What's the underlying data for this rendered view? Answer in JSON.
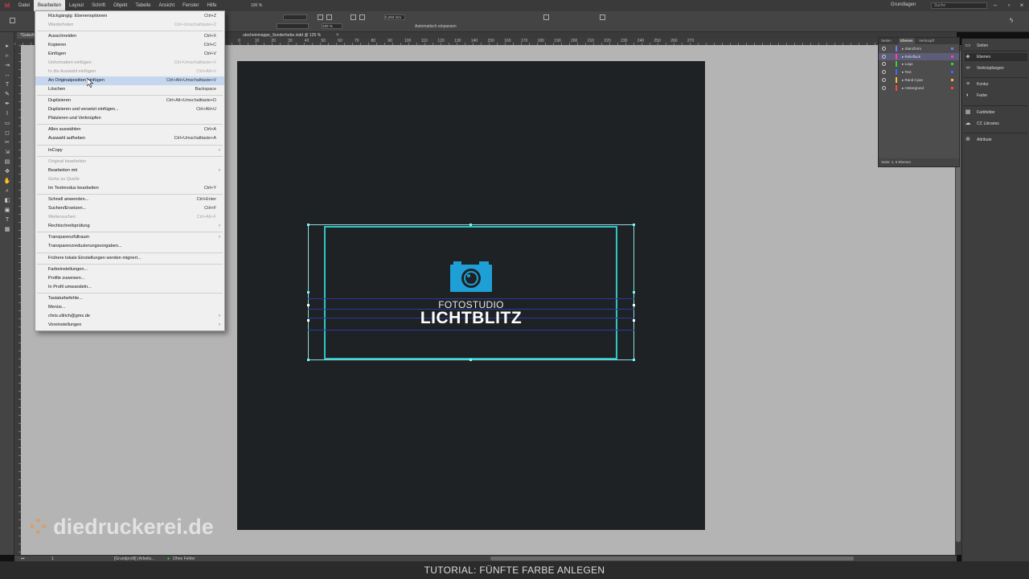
{
  "menubar": {
    "app_logo": "Id",
    "items": [
      "Datei",
      "Bearbeiten",
      "Layout",
      "Schrift",
      "Objekt",
      "Tabelle",
      "Ansicht",
      "Fenster",
      "Hilfe"
    ],
    "zoom": "100 %",
    "workspace": "Grundlagen",
    "search_placeholder": "Suche"
  },
  "controlbar": {
    "stroke_value": "0,283 mm",
    "opacity_value": "100 %",
    "auto_fit_label": "Automatisch einpassen"
  },
  "document": {
    "tab_left": "*Gutsche",
    "tab_title": "utscheinmappe_Sonderfarbe.indd @ 125 %"
  },
  "ruler_labels": [
    "0",
    "10",
    "20",
    "30",
    "40",
    "50",
    "60",
    "70",
    "80",
    "90",
    "100",
    "110",
    "120",
    "130",
    "140",
    "150",
    "160",
    "170",
    "180",
    "190",
    "200",
    "210",
    "220",
    "230",
    "240",
    "250",
    "260",
    "270"
  ],
  "edit_menu": [
    {
      "label": "Rückgängig: Ebenenoptionen",
      "shortcut": "Ctrl+Z",
      "disabled": false
    },
    {
      "label": "Wiederholen",
      "shortcut": "Ctrl+Umschalttaste+Z",
      "disabled": true
    },
    {
      "sep": true
    },
    {
      "label": "Ausschneiden",
      "shortcut": "Ctrl+X",
      "disabled": false
    },
    {
      "label": "Kopieren",
      "shortcut": "Ctrl+C",
      "disabled": false
    },
    {
      "label": "Einfügen",
      "shortcut": "Ctrl+V",
      "disabled": false
    },
    {
      "label": "Unformatiert einfügen",
      "shortcut": "Ctrl+Umschalttaste+V",
      "disabled": true
    },
    {
      "label": "In die Auswahl einfügen",
      "shortcut": "Ctrl+Alt+V",
      "disabled": true
    },
    {
      "label": "An Originalposition einfügen",
      "shortcut": "Ctrl+Alt+Umschalttaste+V",
      "disabled": false,
      "highlight": true
    },
    {
      "label": "Löschen",
      "shortcut": "Backspace",
      "disabled": false
    },
    {
      "sep": true
    },
    {
      "label": "Duplizieren",
      "shortcut": "Ctrl+Alt+Umschalttaste+D",
      "disabled": false
    },
    {
      "label": "Duplizieren und versetzt einfügen...",
      "shortcut": "Ctrl+Alt+U",
      "disabled": false
    },
    {
      "label": "Platzieren und Verknüpfen",
      "shortcut": "",
      "disabled": false
    },
    {
      "sep": true
    },
    {
      "label": "Alles auswählen",
      "shortcut": "Ctrl+A",
      "disabled": false
    },
    {
      "label": "Auswahl aufheben",
      "shortcut": "Ctrl+Umschalttaste+A",
      "disabled": false
    },
    {
      "sep": true
    },
    {
      "label": "InCopy",
      "shortcut": "",
      "submenu": true,
      "disabled": false
    },
    {
      "sep": true
    },
    {
      "label": "Original bearbeiten",
      "shortcut": "",
      "disabled": true
    },
    {
      "label": "Bearbeiten mit",
      "shortcut": "",
      "submenu": true,
      "disabled": false
    },
    {
      "label": "Gehe zu Quelle",
      "shortcut": "",
      "disabled": true
    },
    {
      "label": "Im Textmodus bearbeiten",
      "shortcut": "Ctrl+Y",
      "disabled": false
    },
    {
      "sep": true
    },
    {
      "label": "Schnell anwenden...",
      "shortcut": "Ctrl+Enter",
      "disabled": false
    },
    {
      "label": "Suchen/Ersetzen...",
      "shortcut": "Ctrl+F",
      "disabled": false
    },
    {
      "label": "Weitersuchen",
      "shortcut": "Ctrl+Alt+F",
      "disabled": true
    },
    {
      "label": "Rechtschreibprüfung",
      "shortcut": "",
      "submenu": true,
      "disabled": false
    },
    {
      "sep": true
    },
    {
      "label": "Transparenzfüllraum",
      "shortcut": "",
      "submenu": true,
      "disabled": false
    },
    {
      "label": "Transparenzreduzierungsvorgaben...",
      "shortcut": "",
      "disabled": false
    },
    {
      "sep": true
    },
    {
      "label": "Frühere lokale Einstellungen werden migriert...",
      "shortcut": "",
      "disabled": false
    },
    {
      "sep": true
    },
    {
      "label": "Farbeinstellungen...",
      "shortcut": "",
      "disabled": false
    },
    {
      "label": "Profile zuweisen...",
      "shortcut": "",
      "disabled": false
    },
    {
      "label": "In Profil umwandeln...",
      "shortcut": "",
      "disabled": false
    },
    {
      "sep": true
    },
    {
      "label": "Tastaturbefehle...",
      "shortcut": "",
      "disabled": false
    },
    {
      "label": "Menüs...",
      "shortcut": "",
      "disabled": false
    },
    {
      "label": "chris.ullrich@gmx.de",
      "shortcut": "",
      "submenu": true,
      "disabled": false
    },
    {
      "label": "Voreinstellungen",
      "shortcut": "",
      "submenu": true,
      "disabled": false
    }
  ],
  "artwork": {
    "line1": "FOTOSTUDIO",
    "line2": "LICHTBLITZ",
    "accent": "#2fc5c5",
    "camera_color": "#1ea0d6"
  },
  "layers_panel": {
    "tabs": [
      "Seiten",
      "Ebenen",
      "Verknüpfl"
    ],
    "layers": [
      {
        "name": "Stanzform",
        "color": "#7777ff",
        "selected": false
      },
      {
        "name": "Relieflack",
        "color": "#ff3fb4",
        "selected": true
      },
      {
        "name": "Logo",
        "color": "#3ad13a",
        "selected": false
      },
      {
        "name": "Text",
        "color": "#3a6bff",
        "selected": false
      },
      {
        "name": "Rand Cyan",
        "color": "#ffbb33",
        "selected": false
      },
      {
        "name": "Hintergrund",
        "color": "#ff4444",
        "selected": false
      }
    ],
    "footer": "Seite: 1, 6 Ebenen"
  },
  "right_panels": [
    {
      "label": "Seiten",
      "icon": "▭",
      "active": false
    },
    {
      "label": "Ebenen",
      "icon": "◈",
      "active": true
    },
    {
      "label": "Verknüpfungen",
      "icon": "∞",
      "active": false
    },
    {
      "label": "Kontur",
      "icon": "≡",
      "active": false
    },
    {
      "label": "Farbe",
      "icon": "◐",
      "active": false
    },
    {
      "label": "Farbfelder",
      "icon": "▦",
      "active": false
    },
    {
      "label": "CC Libraries",
      "icon": "☁",
      "active": false
    },
    {
      "label": "Attribute",
      "icon": "⊕",
      "active": false
    }
  ],
  "statusbar": {
    "page": "1",
    "profile": "[Grundprofil] (Arbeits...",
    "errors": "Ohne Fehler"
  },
  "watermark": "diedruckerei.de",
  "caption": "TUTORIAL: FÜNFTE FARBE ANLEGEN"
}
